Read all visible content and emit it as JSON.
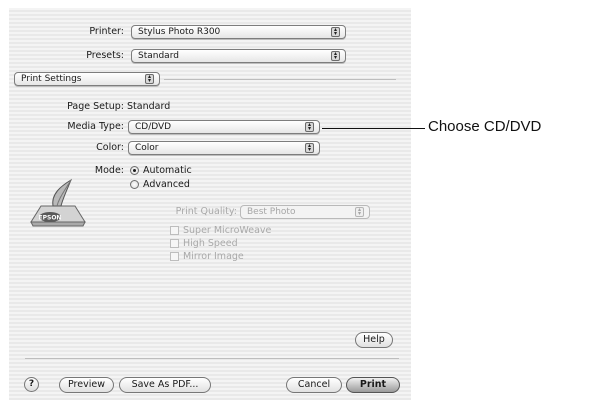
{
  "dialog": {
    "printer": {
      "label": "Printer:",
      "value": "Stylus Photo R300"
    },
    "presets": {
      "label": "Presets:",
      "value": "Standard"
    },
    "pane": {
      "value": "Print Settings"
    },
    "page_setup": {
      "label": "Page Setup:",
      "value": "Standard"
    },
    "media_type": {
      "label": "Media Type:",
      "value": "CD/DVD"
    },
    "color": {
      "label": "Color:",
      "value": "Color"
    },
    "mode": {
      "label": "Mode:",
      "automatic": "Automatic",
      "advanced": "Advanced",
      "selected": "Automatic"
    },
    "print_quality": {
      "label": "Print Quality:",
      "value": "Best Photo"
    },
    "options": {
      "super_microweave": "Super MicroWeave",
      "high_speed": "High Speed",
      "mirror_image": "Mirror Image"
    },
    "logo_text": "EPSON",
    "buttons": {
      "help_icon": "?",
      "help": "Help",
      "preview": "Preview",
      "save_pdf": "Save As PDF...",
      "cancel": "Cancel",
      "print": "Print"
    }
  },
  "callout": {
    "text": "Choose CD/DVD"
  },
  "icons": {
    "popup_arrow": "up-down-arrows-icon",
    "logo": "epson-printer-icon",
    "help": "question-mark-icon"
  }
}
